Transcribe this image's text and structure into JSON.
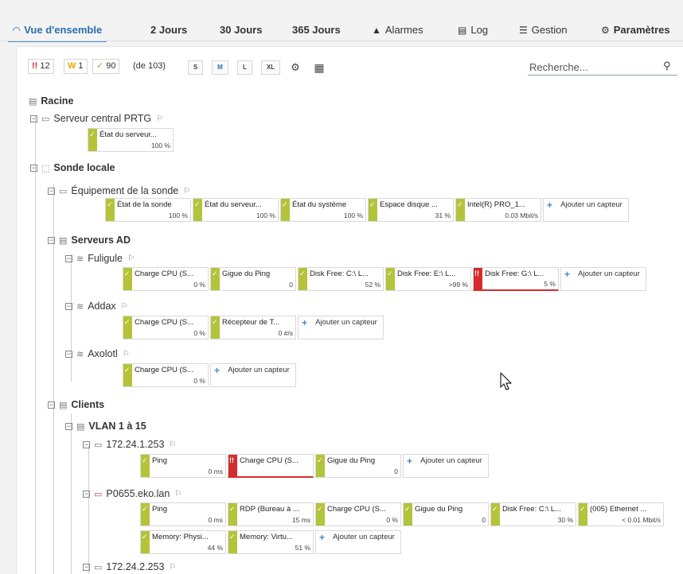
{
  "tabs": [
    {
      "label": "Vue d'ensemble",
      "icon": "gauge-icon",
      "active": true
    },
    {
      "label": "2  Jours",
      "bold": "2"
    },
    {
      "label": "30 Jours",
      "bold": "30"
    },
    {
      "label": "365 Jours",
      "bold": "365"
    },
    {
      "label": "Alarmes",
      "icon": "warning-icon"
    },
    {
      "label": "Log",
      "icon": "log-icon"
    },
    {
      "label": "Gestion",
      "icon": "sliders-icon"
    },
    {
      "label": "Paramètres",
      "icon": "gear-icon"
    }
  ],
  "toolbar": {
    "down_sym": "!!",
    "down_count": "12",
    "warn_sym": "W",
    "warn_count": "1",
    "ok_sym": "✓",
    "ok_count": "90",
    "total": "(de 103)",
    "sizes": [
      "S",
      "M",
      "L",
      "XL"
    ],
    "active_size": "M",
    "search_placeholder": "Recherche..."
  },
  "tree": {
    "root": "Racine",
    "server": "Serveur central PRTG",
    "probe": "Sonde locale",
    "probe_device": "Équipement de la sonde",
    "group_ad": "Serveurs AD",
    "fuligule": "Fuligule",
    "addax": "Addax",
    "axolotl": "Axolotl",
    "clients": "Clients",
    "vlan": "VLAN 1 à 15",
    "host1": "172.24.1.253",
    "host2": "P0655.eko.lan",
    "host3": "172.24.2.253"
  },
  "add_sensor": "Ajouter un capteur",
  "sensors": {
    "server": [
      {
        "name": "État du serveur...",
        "value": "100 %",
        "status": "ok"
      }
    ],
    "probe_device": [
      {
        "name": "État de la sonde",
        "value": "100 %",
        "status": "ok"
      },
      {
        "name": "État du serveur...",
        "value": "100 %",
        "status": "ok"
      },
      {
        "name": "État du système",
        "value": "100 %",
        "status": "ok"
      },
      {
        "name": "Espace disque ...",
        "value": "31 %",
        "status": "ok"
      },
      {
        "name": "Intel(R) PRO_1...",
        "value": "0.03 Mbit/s",
        "status": "ok"
      }
    ],
    "fuligule": [
      {
        "name": "Charge CPU (S...",
        "value": "0 %",
        "status": "ok"
      },
      {
        "name": "Gigue du Ping",
        "value": "0",
        "status": "ok"
      },
      {
        "name": "Disk Free: C:\\ L...",
        "value": "52 %",
        "status": "ok"
      },
      {
        "name": "Disk Free: E:\\ L...",
        "value": ">99 %",
        "status": "ok"
      },
      {
        "name": "Disk Free: G:\\ L...",
        "value": "5 %",
        "status": "down"
      }
    ],
    "addax": [
      {
        "name": "Charge CPU (S...",
        "value": "0 %",
        "status": "ok"
      },
      {
        "name": "Récepteur de T...",
        "value": "0 #/s",
        "status": "ok"
      }
    ],
    "axolotl": [
      {
        "name": "Charge CPU (S...",
        "value": "0 %",
        "status": "ok"
      }
    ],
    "host1": [
      {
        "name": "Ping",
        "value": "0 ms",
        "status": "ok"
      },
      {
        "name": "Charge CPU (S...",
        "value": "",
        "status": "down"
      },
      {
        "name": "Gigue du Ping",
        "value": "0",
        "status": "ok"
      }
    ],
    "host2_row1": [
      {
        "name": "Ping",
        "value": "0 ms",
        "status": "ok"
      },
      {
        "name": "RDP (Bureau à ...",
        "value": "15 ms",
        "status": "ok"
      },
      {
        "name": "Charge CPU (S...",
        "value": "0 %",
        "status": "ok"
      },
      {
        "name": "Gigue du Ping",
        "value": "0",
        "status": "ok"
      },
      {
        "name": "Disk Free: C:\\ L...",
        "value": "30 %",
        "status": "ok"
      },
      {
        "name": "(005) Ethernet ...",
        "value": "< 0.01 Mbit/s",
        "status": "ok"
      }
    ],
    "host2_row2": [
      {
        "name": "Memory: Physi...",
        "value": "44 %",
        "status": "ok"
      },
      {
        "name": "Memory: Virtu...",
        "value": "51 %",
        "status": "ok"
      }
    ]
  },
  "colors": {
    "ok": "#b4c43a",
    "down": "#d42c2c",
    "accent": "#4a90d9"
  }
}
